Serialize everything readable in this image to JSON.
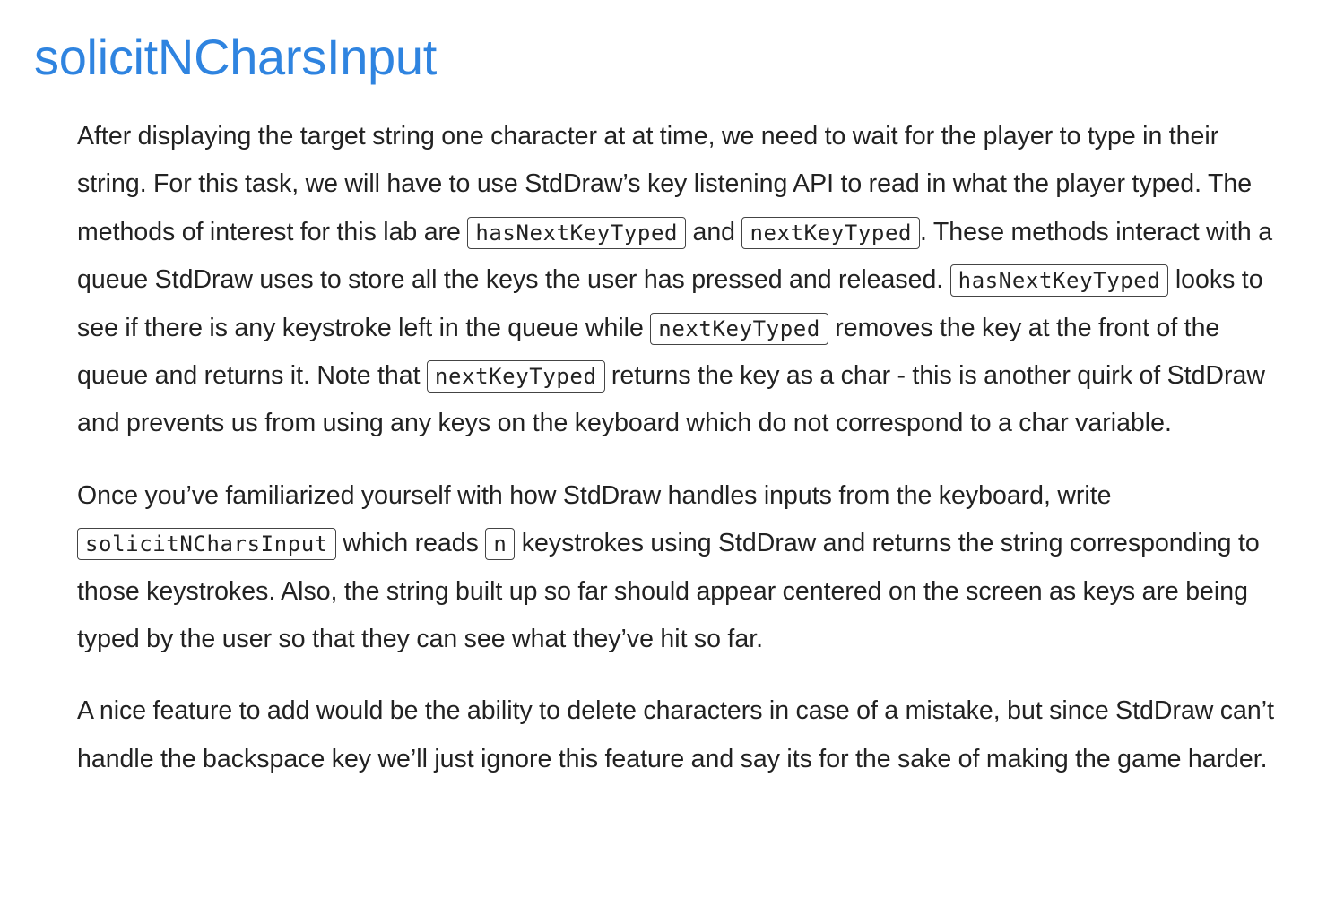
{
  "heading": {
    "title": "solicitNCharsInput"
  },
  "paragraphs": {
    "p1": {
      "t1": "After displaying the target string one character at at time, we need to wait for the player to type in their string. For this task, we will have to use StdDraw’s key listening API to read in what the player typed. The methods of interest for this lab are ",
      "c1": "hasNextKeyTyped",
      "t2": " and ",
      "c2": "nextKeyTyped",
      "t3": ". These methods interact with a queue StdDraw uses to store all the keys the user has pressed and released. ",
      "c3": "hasNextKeyTyped",
      "t4": " looks to see if there is any keystroke left in the queue while ",
      "c4": "nextKeyTyped",
      "t5": " removes the key at the front of the queue and returns it. Note that ",
      "c5": "nextKeyTyped",
      "t6": " returns the key as a char - this is another quirk of StdDraw and prevents us from using any keys on the keyboard which do not correspond to a char variable."
    },
    "p2": {
      "t1": "Once you’ve familiarized yourself with how StdDraw handles inputs from the keyboard, write ",
      "c1": "solicitNCharsInput",
      "t2": " which reads ",
      "c2": "n",
      "t3": " keystrokes using StdDraw and returns the string corresponding to those keystrokes. Also, the string built up so far should appear centered on the screen as keys are being typed by the user so that they can see what they’ve hit so far."
    },
    "p3": {
      "t1": "A nice feature to add would be the ability to delete characters in case of a mistake, but since StdDraw can’t handle the backspace key we’ll just ignore this feature and say its for the sake of making the game harder."
    }
  },
  "colors": {
    "heading": "#2f84e0",
    "text": "#222222",
    "code_border": "#444444"
  }
}
